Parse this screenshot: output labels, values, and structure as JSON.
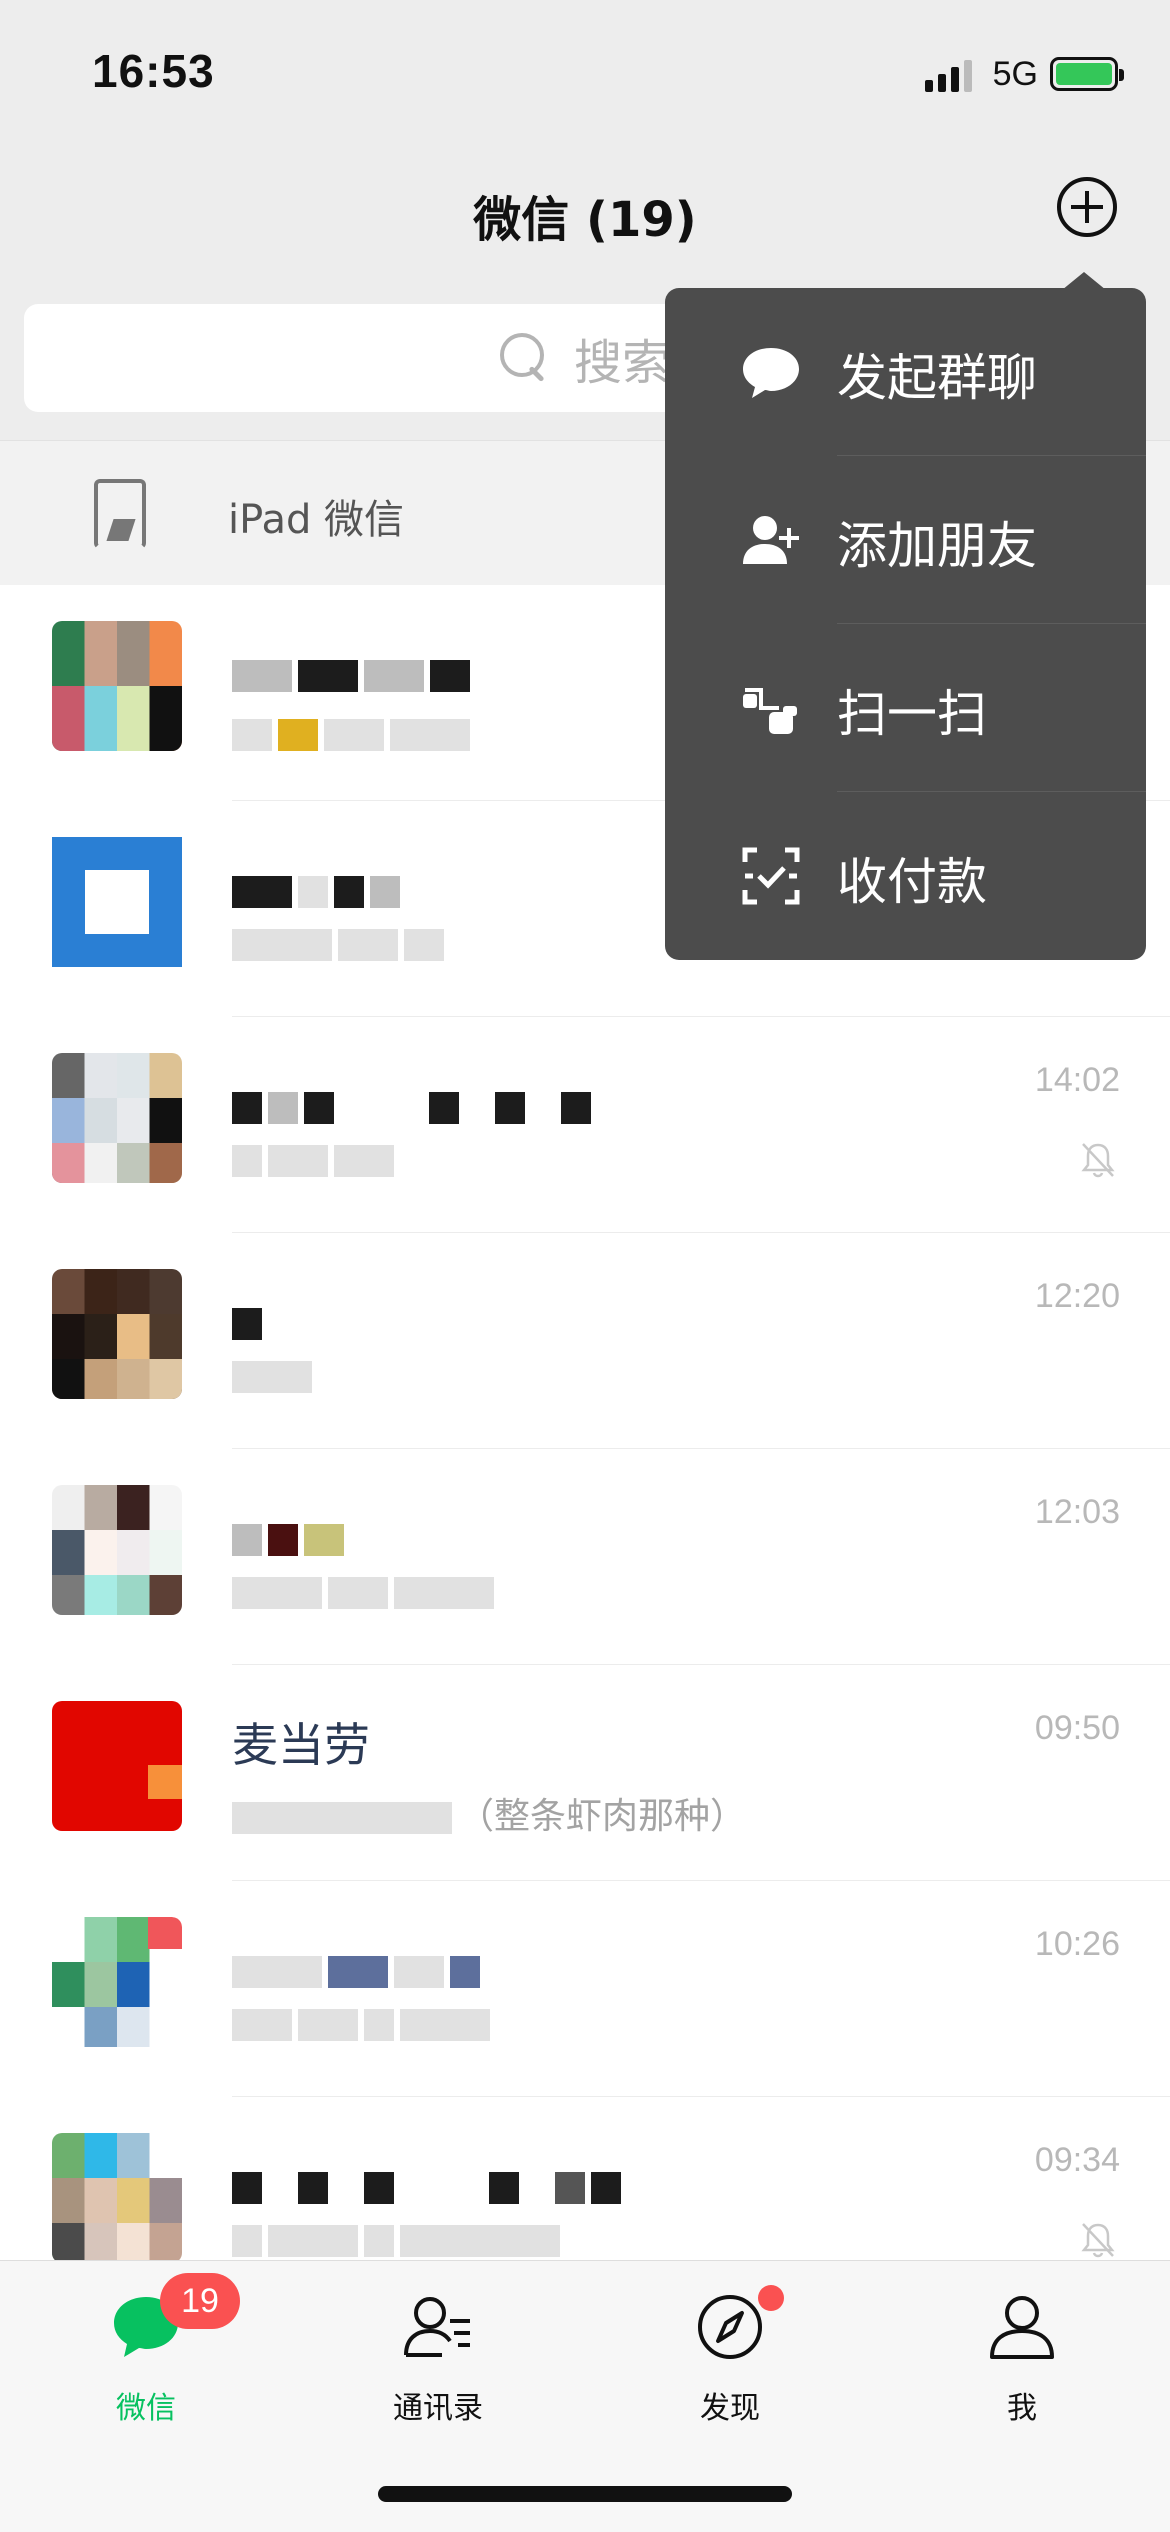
{
  "status_bar": {
    "time": "16:53",
    "network": "5G"
  },
  "nav": {
    "title": "微信 (19)"
  },
  "search": {
    "placeholder": "搜索"
  },
  "ipad": {
    "label": "iPad 微信"
  },
  "chats": [
    {
      "time": "",
      "muted": false,
      "name": "",
      "preview": ""
    },
    {
      "time": "",
      "muted": false,
      "name": "",
      "preview": ""
    },
    {
      "time": "14:02",
      "muted": true,
      "name": "",
      "preview": ""
    },
    {
      "time": "12:20",
      "muted": false,
      "name": "",
      "preview": ""
    },
    {
      "time": "12:03",
      "muted": false,
      "name": "",
      "preview": ""
    },
    {
      "time": "09:50",
      "muted": false,
      "name": "麦当劳",
      "preview": "（整条虾肉那种）"
    },
    {
      "time": "10:26",
      "muted": false,
      "name": "",
      "preview": ""
    },
    {
      "time": "09:34",
      "muted": true,
      "name": "",
      "preview": ""
    }
  ],
  "menu": {
    "items": [
      {
        "label": "发起群聊",
        "icon": "chat-bubble-icon"
      },
      {
        "label": "添加朋友",
        "icon": "add-friend-icon"
      },
      {
        "label": "扫一扫",
        "icon": "scan-icon"
      },
      {
        "label": "收付款",
        "icon": "payment-icon"
      }
    ]
  },
  "tabs": [
    {
      "label": "微信",
      "badge": "19",
      "icon": "chats-icon",
      "active": true
    },
    {
      "label": "通讯录",
      "icon": "contacts-icon",
      "active": false
    },
    {
      "label": "发现",
      "icon": "discover-icon",
      "active": false,
      "dot": true
    },
    {
      "label": "我",
      "icon": "me-icon",
      "active": false
    }
  ],
  "colors": {
    "accent": "#07c160",
    "badge": "#fa5151",
    "menu_bg": "#4c4c4c"
  }
}
